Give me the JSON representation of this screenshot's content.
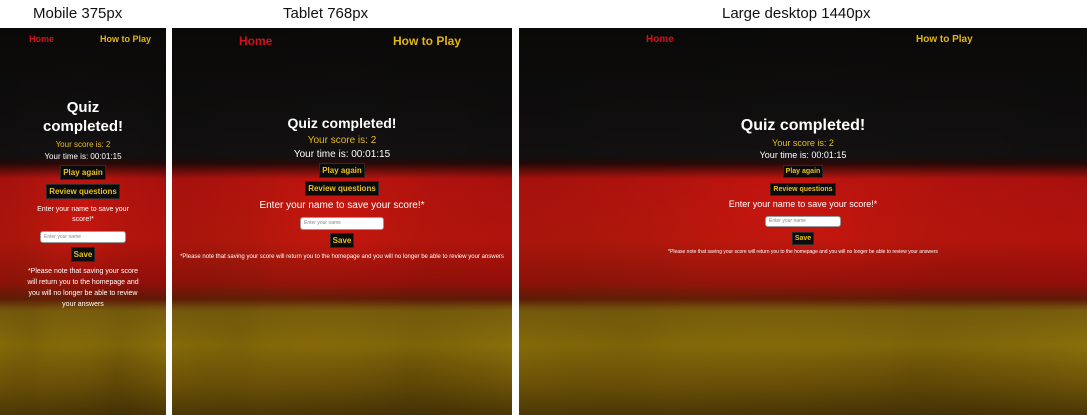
{
  "captions": {
    "mobile": "Mobile 375px",
    "tablet": "Tablet 768px",
    "desktop": "Large desktop 1440px"
  },
  "nav": {
    "home": "Home",
    "how_to_play": "How to Play"
  },
  "quiz": {
    "title": "Quiz completed!",
    "score_text": "Your score is: 2",
    "time_text": "Your time is: 00:01:15",
    "play_again": "Play again",
    "review_questions": "Review questions",
    "enter_name_label": "Enter your name to save your score!*",
    "name_placeholder": "Enter your name",
    "save": "Save",
    "note": "*Please note that saving your score will return you to the homepage and you will no longer be able to review your answers"
  },
  "colors": {
    "home_link": "#d0121a",
    "how_to_play_link": "#e2b614",
    "score_text": "#e9bd1b",
    "button_bg": "#0b0b0b",
    "button_text": "#e8c11d",
    "flag_black": "#141212",
    "flag_red": "#d8160f",
    "flag_gold": "#b8950e"
  }
}
